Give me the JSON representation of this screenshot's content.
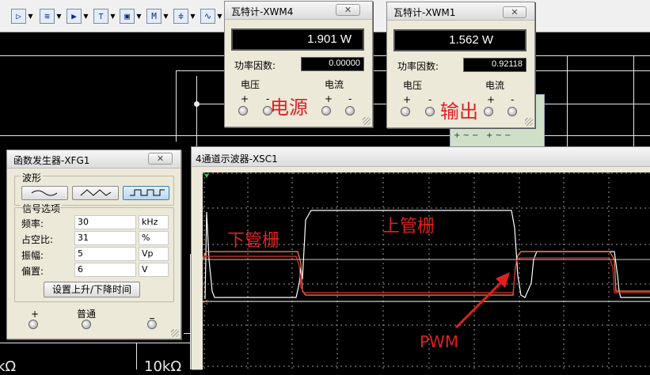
{
  "toolbar": {
    "buttons": [
      {
        "icon": "power-source-icon",
        "glyph": "▷"
      },
      {
        "icon": "signal-source-icon",
        "glyph": "≋"
      },
      {
        "icon": "diode-icon",
        "glyph": "▶"
      },
      {
        "icon": "transistor-icon",
        "glyph": "⊤"
      },
      {
        "icon": "analog-ic-icon",
        "glyph": "▣"
      },
      {
        "icon": "ttl-icon",
        "glyph": "M"
      },
      {
        "icon": "cmos-icon",
        "glyph": "≑"
      },
      {
        "icon": "misc-digital-icon",
        "glyph": "∿"
      }
    ]
  },
  "wattmeter_xwm4": {
    "title": "瓦特计-XWM4",
    "power_reading": "1.901 W",
    "pf_label": "功率因数:",
    "pf_value": "0.00000",
    "voltage_label": "电压",
    "current_label": "电流",
    "plus": "+",
    "minus": "-"
  },
  "wattmeter_xwm1": {
    "title": "瓦特计-XWM1",
    "power_reading": "1.562 W",
    "pf_label": "功率因数:",
    "pf_value": "0.92118",
    "voltage_label": "电压",
    "current_label": "电流",
    "plus": "+",
    "minus": "-"
  },
  "function_generator": {
    "title": "函数发生器-XFG1",
    "waveform_group": "波形",
    "waveforms": [
      "sine",
      "triangle",
      "square"
    ],
    "selected_waveform": "square",
    "options_group": "信号选项",
    "fields": [
      {
        "label": "频率:",
        "value": "30",
        "unit": "kHz"
      },
      {
        "label": "占空比:",
        "value": "31",
        "unit": "%"
      },
      {
        "label": "振幅:",
        "value": "5",
        "unit": "Vp"
      },
      {
        "label": "偏置:",
        "value": "6",
        "unit": "V"
      }
    ],
    "rise_fall_button": "设置上升/下降时间",
    "plus": "+",
    "common": "普通",
    "minus": "_"
  },
  "oscilloscope": {
    "title": "4通道示波器-XSC1"
  },
  "annotations": {
    "power_source": "电源",
    "output": "输出",
    "lower_gate": "下管栅",
    "upper_gate": "上管栅",
    "pwm": "PWM"
  },
  "schematic": {
    "resistor_label": "10kΩ",
    "partial_label": "kΩ"
  },
  "colors": {
    "scope_bg": "#000000",
    "trace_white": "#ffffff",
    "trace_orange": "#ff8a50",
    "trace_red": "#e03030",
    "annotation": "#e02020",
    "grid": "#9a9a9a"
  }
}
